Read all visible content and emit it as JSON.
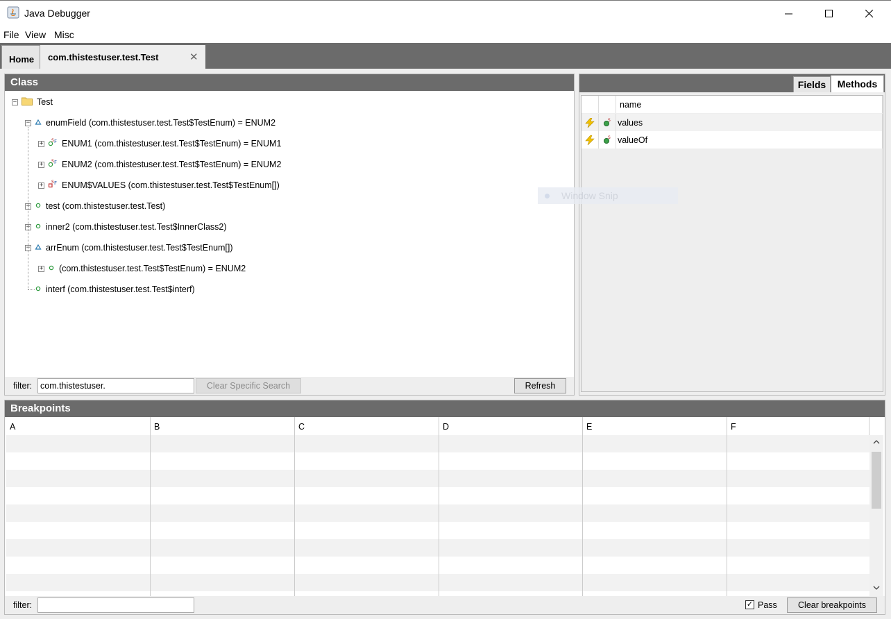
{
  "window": {
    "title": "Java Debugger"
  },
  "menu": {
    "items": [
      "File",
      "View",
      "Misc"
    ]
  },
  "tabs": [
    {
      "label": "Home",
      "closable": false
    },
    {
      "label": "com.thistestuser.test.Test",
      "closable": true,
      "close_glyph": "✕"
    }
  ],
  "class_panel": {
    "title": "Class",
    "tree": [
      {
        "label": "Test",
        "icon": "folder-icon",
        "level": 0,
        "expander": "−"
      },
      {
        "label": "enumField (com.thistestuser.test.Test$TestEnum) = ENUM2",
        "icon": "static-field-icon",
        "level": 1,
        "expander": "−"
      },
      {
        "label": "ENUM1 (com.thistestuser.test.Test$TestEnum) = ENUM1",
        "icon": "static-final-field-icon",
        "level": 2,
        "expander": "+"
      },
      {
        "label": "ENUM2 (com.thistestuser.test.Test$TestEnum) = ENUM2",
        "icon": "static-final-field-icon",
        "level": 2,
        "expander": "+"
      },
      {
        "label": "ENUM$VALUES (com.thistestuser.test.Test$TestEnum[])",
        "icon": "static-final-private-field-icon",
        "level": 2,
        "expander": "+"
      },
      {
        "label": "test (com.thistestuser.test.Test)",
        "icon": "field-icon",
        "level": 1,
        "expander": "+"
      },
      {
        "label": "inner2 (com.thistestuser.test.Test$InnerClass2)",
        "icon": "field-icon",
        "level": 1,
        "expander": "+"
      },
      {
        "label": "arrEnum (com.thistestuser.test.Test$TestEnum[])",
        "icon": "static-field-icon",
        "level": 1,
        "expander": "−"
      },
      {
        "label": "(com.thistestuser.test.Test$TestEnum) = ENUM2",
        "icon": "field-icon",
        "level": 2,
        "expander": "+"
      },
      {
        "label": "interf (com.thistestuser.test.Test$interf)",
        "icon": "field-icon",
        "level": 1,
        "expander": ""
      }
    ],
    "filter_label": "filter:",
    "filter_value": "com.thistestuser.",
    "clear_button": "Clear Specific Search",
    "refresh_button": "Refresh"
  },
  "members_panel": {
    "tabs": [
      "Fields",
      "Methods"
    ],
    "selected_tab": "Methods",
    "column_header": "name",
    "methods": [
      {
        "name": "values",
        "icon": "lightning-icon",
        "modifier_icon": "static-method-icon"
      },
      {
        "name": "valueOf",
        "icon": "lightning-icon",
        "modifier_icon": "static-method-icon"
      }
    ]
  },
  "overlay": {
    "label": "Window Snip"
  },
  "breakpoints_panel": {
    "title": "Breakpoints",
    "columns": [
      "A",
      "B",
      "C",
      "D",
      "E",
      "F"
    ],
    "filter_label": "filter:",
    "filter_value": "",
    "pass_label": "Pass",
    "pass_checked": true,
    "clear_button": "Clear breakpoints"
  },
  "colors": {
    "header_bg": "#6b6b6b",
    "panel_bg": "#eeeeee",
    "stripe": "#f2f2f2"
  }
}
